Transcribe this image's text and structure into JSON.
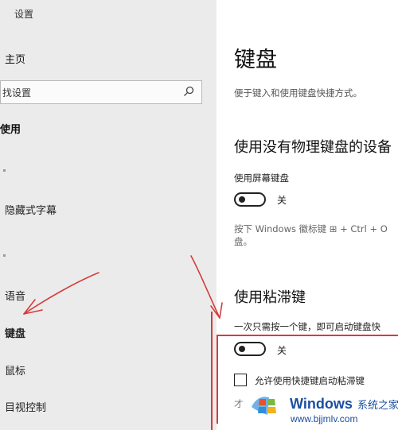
{
  "window": {
    "title": "设置"
  },
  "sidebar": {
    "home_label": "主页",
    "search_placeholder": "找设置",
    "section_title": "使用",
    "items": [
      {
        "label": "隐藏式字幕"
      },
      {
        "label": "语音"
      },
      {
        "label": "键盘"
      },
      {
        "label": "鼠标"
      },
      {
        "label": "目视控制"
      }
    ]
  },
  "main": {
    "title": "键盘",
    "description": "便于键入和使用键盘快捷方式。",
    "section1": {
      "heading": "使用没有物理键盘的设备",
      "toggle_label": "使用屏幕键盘",
      "toggle_state": "关",
      "hint_line1": "按下 Windows 徽标键 ⊞ + Ctrl + O",
      "hint_line2": "盘。"
    },
    "section2": {
      "heading": "使用粘滞键",
      "description": "一次只需按一个键，即可启动键盘快",
      "toggle_state": "关",
      "checkbox_label": "允许使用快捷键启动粘滞键",
      "partial_text": "才"
    }
  },
  "watermark": {
    "name": "Windows",
    "name_cn": "系统之家",
    "url": "www.bjjmlv.com"
  },
  "colors": {
    "annotation_red": "#d43c3c",
    "watermark_blue": "#1b4fa0"
  }
}
